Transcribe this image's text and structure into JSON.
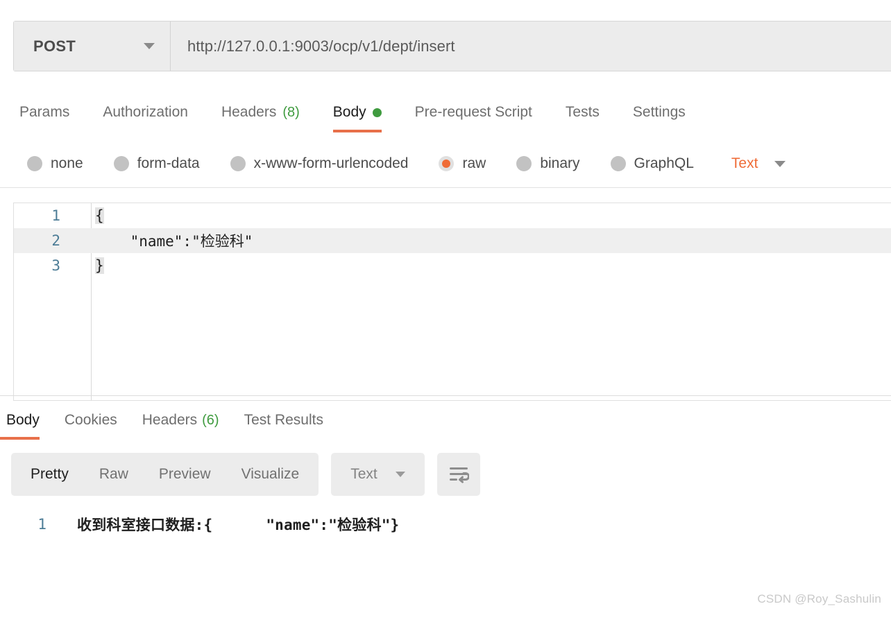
{
  "request": {
    "method": "POST",
    "method_caret_icon": "chevron-down-icon",
    "url": "http://127.0.0.1:9003/ocp/v1/dept/insert",
    "url_placeholder": "Enter request URL",
    "tabs": [
      {
        "label": "Params",
        "count": "",
        "active": false,
        "dot": false
      },
      {
        "label": "Authorization",
        "count": "",
        "active": false,
        "dot": false
      },
      {
        "label": "Headers",
        "count": "(8)",
        "active": false,
        "dot": false
      },
      {
        "label": "Body",
        "count": "",
        "active": true,
        "dot": true
      },
      {
        "label": "Pre-request Script",
        "count": "",
        "active": false,
        "dot": false
      },
      {
        "label": "Tests",
        "count": "",
        "active": false,
        "dot": false
      },
      {
        "label": "Settings",
        "count": "",
        "active": false,
        "dot": false
      }
    ],
    "body_types": [
      {
        "label": "none",
        "selected": false
      },
      {
        "label": "form-data",
        "selected": false
      },
      {
        "label": "x-www-form-urlencoded",
        "selected": false
      },
      {
        "label": "raw",
        "selected": true
      },
      {
        "label": "binary",
        "selected": false
      },
      {
        "label": "GraphQL",
        "selected": false
      }
    ],
    "raw_format": "Text",
    "raw_format_caret_icon": "chevron-down-icon",
    "editor": {
      "lines": [
        {
          "num": "1",
          "text": "{",
          "highlighted": false,
          "brace": true
        },
        {
          "num": "2",
          "text": "    \"name\":\"检验科\"",
          "highlighted": true,
          "brace": false
        },
        {
          "num": "3",
          "text": "}",
          "highlighted": false,
          "brace": true
        }
      ]
    }
  },
  "response": {
    "tabs": [
      {
        "label": "Body",
        "count": "",
        "active": true
      },
      {
        "label": "Cookies",
        "count": "",
        "active": false
      },
      {
        "label": "Headers",
        "count": "(6)",
        "active": false
      },
      {
        "label": "Test Results",
        "count": "",
        "active": false
      }
    ],
    "view_modes": [
      {
        "label": "Pretty",
        "active": true
      },
      {
        "label": "Raw",
        "active": false
      },
      {
        "label": "Preview",
        "active": false
      },
      {
        "label": "Visualize",
        "active": false
      }
    ],
    "format": "Text",
    "format_caret_icon": "chevron-down-icon",
    "wrap_icon": "wrap-lines-icon",
    "body_lines": [
      {
        "num": "1",
        "text": "收到科室接口数据:{      \"name\":\"检验科\"}"
      }
    ]
  },
  "watermark": "CSDN @Roy_Sashulin",
  "colors": {
    "accent": "#ef6c37",
    "tab_underline": "#e8704a",
    "count_green": "#3f9b3f",
    "gutter_number": "#4c7c96",
    "control_bg": "#ececec"
  }
}
